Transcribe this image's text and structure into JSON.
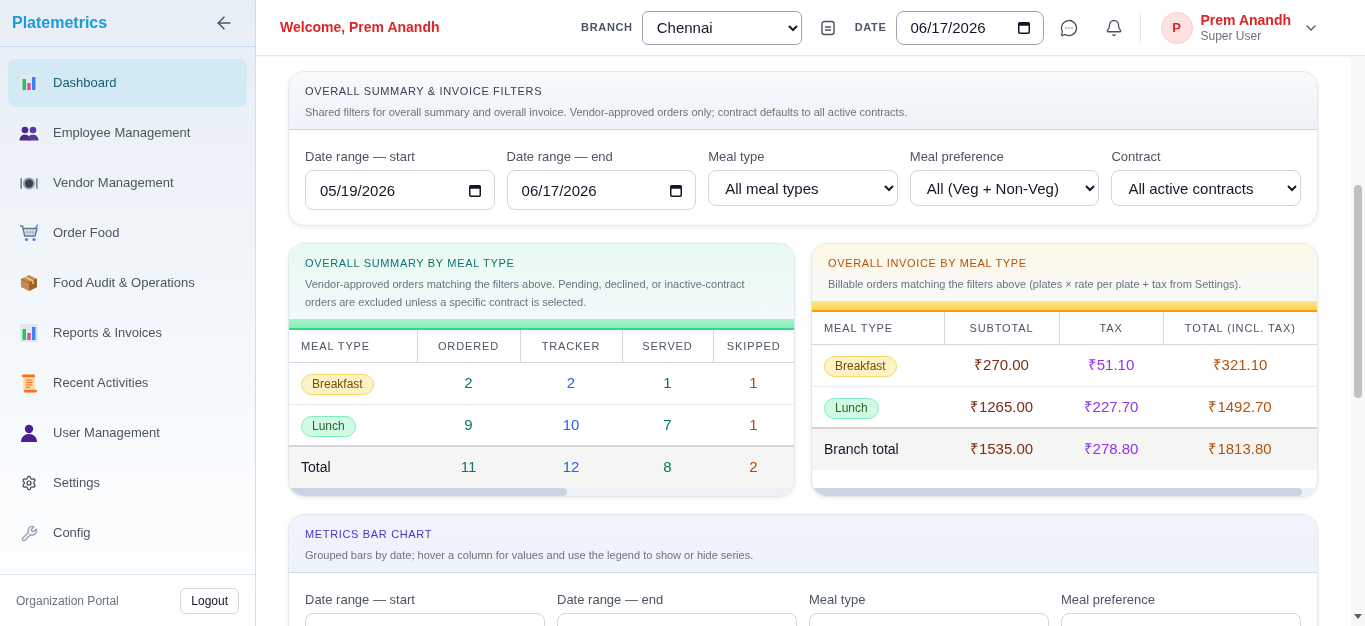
{
  "sidebar": {
    "logo": "Platemetrics",
    "items": [
      {
        "label": "Dashboard",
        "selected": true
      },
      {
        "label": "Employee Management",
        "selected": false
      },
      {
        "label": "Vendor Management",
        "selected": false
      },
      {
        "label": "Order Food",
        "selected": false
      },
      {
        "label": "Food Audit & Operations",
        "selected": false
      },
      {
        "label": "Reports & Invoices",
        "selected": false
      },
      {
        "label": "Recent Activities",
        "selected": false
      },
      {
        "label": "User Management",
        "selected": false
      },
      {
        "label": "Settings",
        "selected": false
      },
      {
        "label": "Config",
        "selected": false
      }
    ],
    "footer_label": "Organization Portal",
    "logout_button": "Logout"
  },
  "header": {
    "welcome": "Welcome, Prem Anandh",
    "branch_label": "BRANCH",
    "branch_value": "Chennai",
    "date_label": "DATE",
    "date_value": "06/17/2026",
    "user": {
      "initial": "P",
      "name": "Prem Anandh",
      "role": "Super User"
    }
  },
  "filters_card": {
    "title": "OVERALL SUMMARY & INVOICE FILTERS",
    "description": "Shared filters for overall summary and overall invoice. Vendor-approved orders only; contract defaults to all active contracts.",
    "fields": [
      {
        "kind": "date",
        "label": "Date range — start",
        "value": "05/19/2026"
      },
      {
        "kind": "date",
        "label": "Date range — end",
        "value": "06/17/2026"
      },
      {
        "kind": "select",
        "label": "Meal type",
        "value": "All meal types"
      },
      {
        "kind": "select",
        "label": "Meal preference",
        "value": "All (Veg + Non-Veg)"
      },
      {
        "kind": "select",
        "label": "Contract",
        "value": "All active contracts"
      }
    ]
  },
  "summary_card": {
    "title": "OVERALL SUMMARY BY MEAL TYPE",
    "description": "Vendor-approved orders matching the filters above. Pending, declined, or inactive-contract orders are excluded unless a specific contract is selected.",
    "columns": [
      {
        "label": "MEAL TYPE"
      },
      {
        "label": "ORDERED",
        "color": "#0f766e"
      },
      {
        "label": "TRACKER",
        "color": "#2563eb"
      },
      {
        "label": "SERVED",
        "color": "#047857"
      },
      {
        "label": "SKIPPED",
        "color": "#c2410c"
      }
    ],
    "rows": [
      {
        "meal": "Breakfast",
        "color": "#fef3c7",
        "values": [
          "2",
          "2",
          "1",
          "1"
        ]
      },
      {
        "meal": "Lunch",
        "color": "#d1fae5",
        "values": [
          "9",
          "10",
          "7",
          "1"
        ]
      }
    ],
    "total": {
      "label": "Total",
      "values": [
        "11",
        "12",
        "8",
        "2"
      ]
    }
  },
  "invoice_card": {
    "title": "OVERALL INVOICE BY MEAL TYPE",
    "description": "Billable orders matching the filters above (plates × rate per plate + tax from Settings).",
    "columns": [
      {
        "label": "MEAL TYPE"
      },
      {
        "label": "SUBTOTAL",
        "color": "#7c2d12"
      },
      {
        "label": "TAX",
        "color": "#9333ea"
      },
      {
        "label": "TOTAL (INCL. TAX)",
        "color": "#b45309"
      }
    ],
    "rows": [
      {
        "meal": "Breakfast",
        "color": "#fef3c7",
        "values": [
          "₹270.00",
          "₹51.10",
          "₹321.10"
        ]
      },
      {
        "meal": "Lunch",
        "color": "#d1fae5",
        "values": [
          "₹1265.00",
          "₹227.70",
          "₹1492.70"
        ]
      }
    ],
    "total": {
      "label": "Branch total",
      "values": [
        "₹1535.00",
        "₹278.80",
        "₹1813.80"
      ]
    }
  },
  "chart_card": {
    "title": "METRICS BAR CHART",
    "description": "Grouped bars by date; hover a column for values and use the legend to show or hide series.",
    "fields": [
      {
        "label": "Date range — start"
      },
      {
        "label": "Date range — end"
      },
      {
        "label": "Meal type"
      },
      {
        "label": "Meal preference"
      }
    ]
  }
}
